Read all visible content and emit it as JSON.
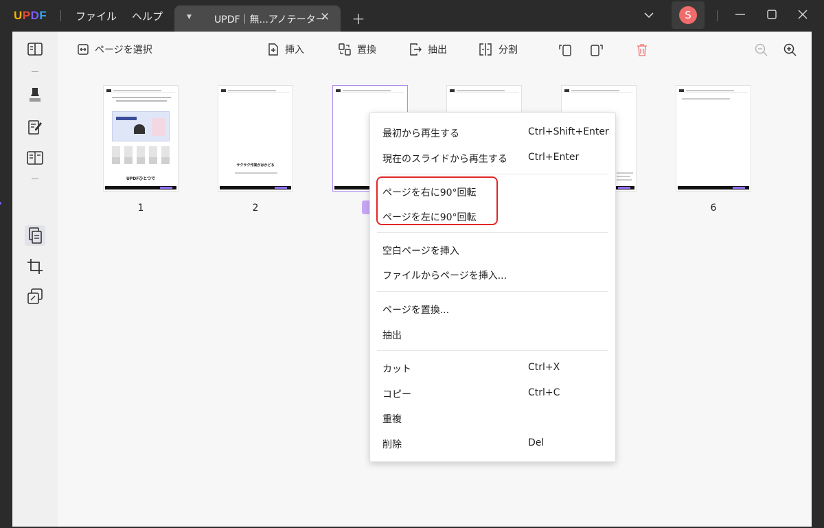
{
  "app": {
    "logo": [
      "U",
      "P",
      "D",
      "F"
    ],
    "menus": [
      "ファイル",
      "ヘルプ"
    ],
    "tab_title": "UPDF｜無...アノテーター",
    "avatar_initial": "S"
  },
  "toolbar": {
    "select_pages": "ページを選択",
    "insert": "挿入",
    "replace": "置換",
    "extract": "抽出",
    "split": "分割"
  },
  "pages": [
    "1",
    "2",
    "6"
  ],
  "thumb_texts": {
    "p1_title": "UPDFひとつで",
    "p2_title": "サクサク作業がはかどる"
  },
  "context_menu": {
    "play_from_start": "最初から再生する",
    "play_from_start_shortcut": "Ctrl+Shift+Enter",
    "play_from_current": "現在のスライドから再生する",
    "play_from_current_shortcut": "Ctrl+Enter",
    "rotate_right": "ページを右に90°回転",
    "rotate_left": "ページを左に90°回転",
    "insert_blank": "空白ページを挿入",
    "insert_from_file": "ファイルからページを挿入...",
    "replace_page": "ページを置換...",
    "extract": "抽出",
    "cut": "カット",
    "cut_shortcut": "Ctrl+X",
    "copy": "コピー",
    "copy_shortcut": "Ctrl+C",
    "duplicate": "重複",
    "delete": "削除",
    "delete_shortcut": "Del"
  },
  "colors": {
    "accent": "#7c5cf5",
    "highlight": "#e32526",
    "delete_icon": "#f08080"
  }
}
